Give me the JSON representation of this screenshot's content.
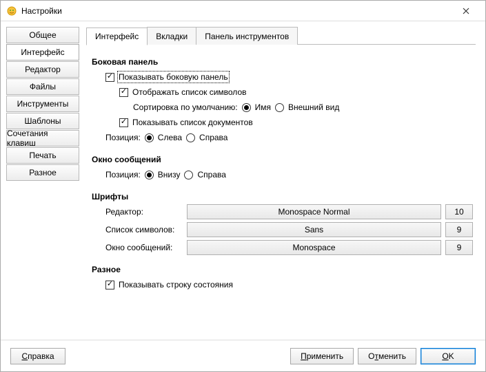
{
  "window": {
    "title": "Настройки"
  },
  "sidebar": {
    "items": [
      {
        "label": "Общее"
      },
      {
        "label": "Интерфейс",
        "active": true
      },
      {
        "label": "Редактор"
      },
      {
        "label": "Файлы"
      },
      {
        "label": "Инструменты"
      },
      {
        "label": "Шаблоны"
      },
      {
        "label": "Сочетания клавиш"
      },
      {
        "label": "Печать"
      },
      {
        "label": "Разное"
      }
    ]
  },
  "tabs": [
    {
      "label": "Интерфейс",
      "active": true
    },
    {
      "label": "Вкладки"
    },
    {
      "label": "Панель инструментов"
    }
  ],
  "sidepanel": {
    "title": "Боковая панель",
    "show": "Показывать боковую панель",
    "listSymbols": "Отображать список символов",
    "sortLabel": "Сортировка по умолчанию:",
    "sortName": "Имя",
    "sortAppearance": "Внешний вид",
    "listDocs": "Показывать список документов",
    "positionLabel": "Позиция:",
    "left": "Слева",
    "right": "Справа"
  },
  "msgwin": {
    "title": "Окно сообщений",
    "positionLabel": "Позиция:",
    "bottom": "Внизу",
    "right": "Справа"
  },
  "fonts": {
    "title": "Шрифты",
    "editorLabel": "Редактор:",
    "editorFont": "Monospace Normal",
    "editorSize": "10",
    "symbolsLabel": "Список символов:",
    "symbolsFont": "Sans",
    "symbolsSize": "9",
    "msgLabel": "Окно сообщений:",
    "msgFont": "Monospace",
    "msgSize": "9"
  },
  "misc": {
    "title": "Разное",
    "showStatus": "Показывать строку состояния"
  },
  "footer": {
    "help_u": "С",
    "help_rest": "правка",
    "apply_u": "П",
    "apply_rest": "рименить",
    "cancel": "О",
    "cancel_u": "т",
    "cancel_rest": "менить",
    "ok_u": "O",
    "ok_rest": "K"
  }
}
